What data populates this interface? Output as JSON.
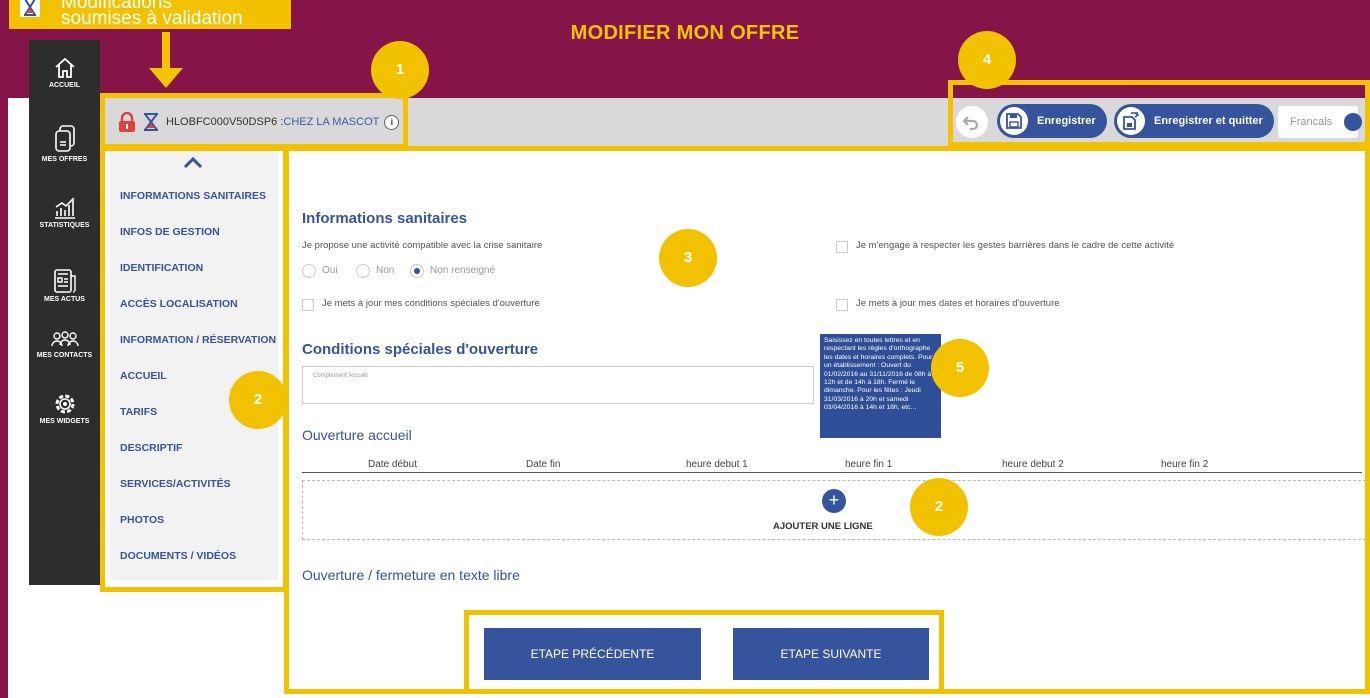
{
  "header": {
    "title": "MODIFIER MON OFFRE",
    "callout_line1": "Modifications",
    "callout_line2": "soumises à validation"
  },
  "sidebar": {
    "items": [
      {
        "label": "ACCUEIL",
        "icon": "home-icon"
      },
      {
        "label": "MES OFFRES",
        "icon": "documents-icon"
      },
      {
        "label": "STATISTIQUES",
        "icon": "chart-icon"
      },
      {
        "label": "MES ACTUS",
        "icon": "news-icon"
      },
      {
        "label": "MES CONTACTS",
        "icon": "contacts-icon"
      },
      {
        "label": "MES WIDGETS",
        "icon": "gear-icon"
      }
    ]
  },
  "breadcrumb": {
    "code": "HLOBFC000V50DSP6 : ",
    "name": "CHEZ LA MASCOT"
  },
  "toolbar": {
    "save_label": "Enregistrer",
    "save_quit_label": "Enregistrer et quitter",
    "language": "Francais"
  },
  "badges": {
    "b1": "1",
    "b2": "2",
    "b3": "3",
    "b4": "4",
    "b5": "5",
    "b2b": "2"
  },
  "menu": {
    "items": [
      "INFORMATIONS SANITAIRES",
      "INFOS DE GESTION",
      "IDENTIFICATION",
      "ACCÈS LOCALISATION",
      "INFORMATION / RÉSERVATION",
      "ACCUEIL",
      "TARIFS",
      "DESCRIPTIF",
      "SERVICES/ACTIVITÉS",
      "PHOTOS",
      "DOCUMENTS / VIDÉOS"
    ]
  },
  "form": {
    "section1_title": "Informations sanitaires",
    "question": "Je propose une activité compatible avec la crise sanitaire",
    "radio_yes": "Oui",
    "radio_no": "Non",
    "radio_unset": "Non renseigné",
    "engage_label": "Je m'engage à respecter les gestes barrières dans le cadre de cette activité",
    "special_cond_label": "Je mets à jour mes conditions spéciales d'ouverture",
    "dates_label": "Je mets à jour mes dates et horaires d'ouverture",
    "section2_title": "Conditions spéciales d'ouverture",
    "textarea_placeholder": "Complément Accueil",
    "tooltip": "Saisissez en toutes lettres et en respectant les règles d'orthographe les dates et horaires complets. Pour un établissement : Ouvert du 01/02/2016 au 31/11/2016 de 08h à 12h et de 14h à 18h. Fermé le dimanche. Pour les fêtes : Jeudi 31/03/2016 à 20h et samedi 03/04/2016 à 14h et 18h, etc...",
    "section3_title": "Ouverture accueil",
    "columns": [
      "Date début",
      "Date fin",
      "heure debut 1",
      "heure fin 1",
      "heure debut 2",
      "heure fin 2"
    ],
    "add_line": "AJOUTER UNE LIGNE",
    "section4_title": "Ouverture / fermeture en texte libre"
  },
  "nav": {
    "prev": "ETAPE PRÉCÉDENTE",
    "next": "ETAPE SUIVANTE"
  },
  "colors": {
    "maroon": "#851449",
    "yellow": "#f2c200",
    "blue": "#35549b",
    "lock_red": "#e0413a"
  }
}
